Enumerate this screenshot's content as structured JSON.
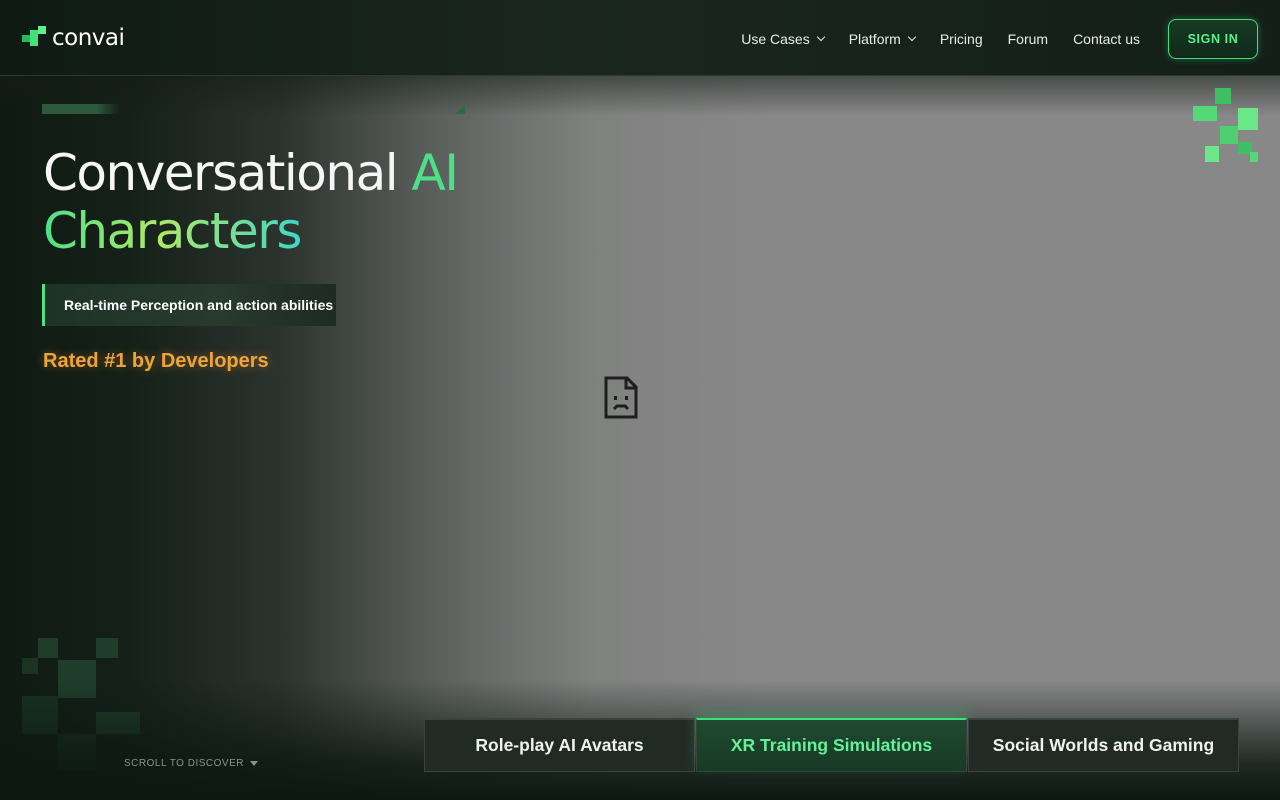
{
  "header": {
    "logo_text": "convai",
    "nav": [
      {
        "label": "Use Cases",
        "dropdown": true
      },
      {
        "label": "Platform",
        "dropdown": true
      },
      {
        "label": "Pricing",
        "dropdown": false
      },
      {
        "label": "Forum",
        "dropdown": false
      },
      {
        "label": "Contact us",
        "dropdown": false
      }
    ],
    "signin_label": "SIGN IN"
  },
  "hero": {
    "headline_part1": "Conversational ",
    "headline_part2": "AI",
    "headline_line2": "Characters",
    "pill_text": "Real-time Perception and action abilities",
    "rated_text": "Rated #1 by Developers",
    "scroll_text": "SCROLL TO DISCOVER"
  },
  "tabs": [
    {
      "label": "Role-play AI Avatars",
      "active": false
    },
    {
      "label": "XR Training Simulations",
      "active": true
    },
    {
      "label": "Social Worlds and Gaming",
      "active": false
    }
  ],
  "icons": {
    "logo": "convai-logo-icon",
    "broken_media": "broken-image-icon",
    "chevron": "chevron-down-icon"
  },
  "colors": {
    "accent": "#4ee086",
    "rated": "#f2a23a",
    "background": "#0d1812"
  }
}
